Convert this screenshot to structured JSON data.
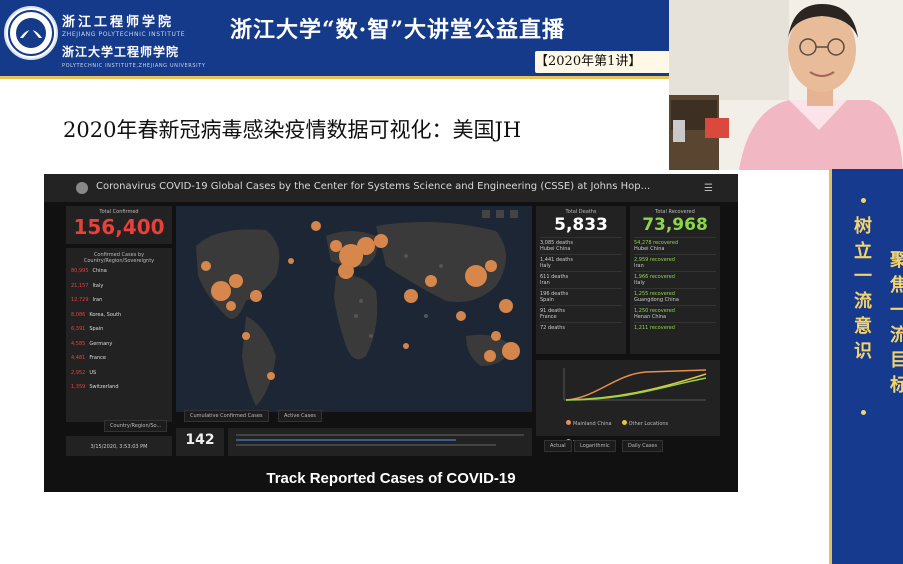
{
  "header": {
    "school_cn": "浙江工程师学院",
    "school_en": "ZHEJIANG POLYTECHNIC INSTITUTE",
    "school2_cn": "浙江大学工程师学院",
    "school2_en": "POLYTECHNIC INSTITUTE,ZHEJIANG UNIVERSITY",
    "lecture_title": "浙江大学“数·智”大讲堂公益直播",
    "lecture_no": "【2020年第1讲】"
  },
  "slide": {
    "heading": "2020年春新冠病毒感染疫情数据可视化：美国JH"
  },
  "dashboard": {
    "title": "Coronavirus COVID-19 Global Cases by the Center for Systems Science and Engineering (CSSE) at Johns Hop...",
    "total_confirmed_label": "Total Confirmed",
    "total_confirmed": "156,400",
    "list_header": "Confirmed Cases by Country/Region/Sovereignty",
    "countries": [
      {
        "n": "80,995",
        "c": "China"
      },
      {
        "n": "21,157",
        "c": "Italy"
      },
      {
        "n": "12,729",
        "c": "Iran"
      },
      {
        "n": "8,086",
        "c": "Korea, South"
      },
      {
        "n": "6,391",
        "c": "Spain"
      },
      {
        "n": "4,585",
        "c": "Germany"
      },
      {
        "n": "4,481",
        "c": "France"
      },
      {
        "n": "2,952",
        "c": "US"
      },
      {
        "n": "1,359",
        "c": "Switzerland"
      }
    ],
    "list_tab": "Country/Region/So...",
    "last_updated": "3/15/2020, 3:53:03 PM",
    "country_count": "142",
    "map_tabs": [
      "Cumulative Confirmed Cases",
      "Active Cases"
    ],
    "deaths_label": "Total Deaths",
    "deaths_total": "5,833",
    "deaths_rows": [
      {
        "n": "3,085 deaths",
        "p": "Hubei China"
      },
      {
        "n": "1,441 deaths",
        "p": "Italy"
      },
      {
        "n": "611 deaths",
        "p": "Iran"
      },
      {
        "n": "196 deaths",
        "p": "Spain"
      },
      {
        "n": "91 deaths",
        "p": "France"
      },
      {
        "n": "72 deaths",
        "p": ""
      }
    ],
    "recovered_label": "Total Recovered",
    "recovered_total": "73,968",
    "recovered_rows": [
      {
        "n": "54,278 recovered",
        "p": "Hubei China"
      },
      {
        "n": "2,959 recovered",
        "p": "Iran"
      },
      {
        "n": "1,966 recovered",
        "p": "Italy"
      },
      {
        "n": "1,255 recovered",
        "p": "Guangdong China"
      },
      {
        "n": "1,250 recovered",
        "p": "Henan China"
      },
      {
        "n": "1,211 recovered",
        "p": ""
      }
    ],
    "chart_tabs": [
      "Actual",
      "Logarithmic",
      "Daily Cases"
    ],
    "chart_legend": [
      "Mainland China",
      "Other Locations",
      "Total Recovered"
    ],
    "footer": "Track Reported Cases of COVID-19"
  },
  "sidebar": {
    "col1": "树立一流意识",
    "col2": "聚焦一流目标"
  },
  "colors": {
    "header_blue": "#153a8a",
    "accent_gold": "#f3d36b",
    "dashboard_bg": "#111111",
    "confirmed_red": "#e8403b",
    "recovered_green": "#8dd548",
    "bubble_orange": "#e8904f"
  }
}
